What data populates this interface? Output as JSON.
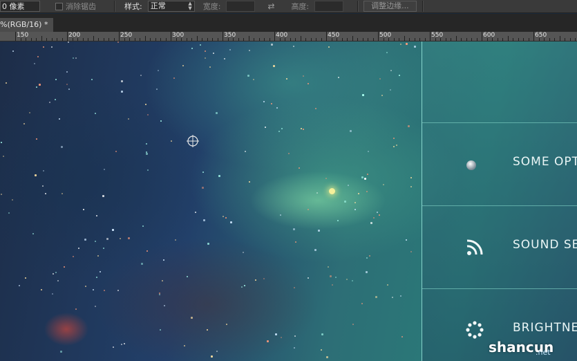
{
  "options_bar": {
    "feather_value": "0 像素",
    "anti_alias_label": "消除锯齿",
    "style_label": "样式:",
    "style_value": "正常",
    "width_label": "宽度:",
    "height_label": "高度:",
    "refine_edge_label": "调整边缘..."
  },
  "document": {
    "tab_title": "%(RGB/16) *"
  },
  "ruler": {
    "labels": [
      "150",
      "200",
      "250",
      "300",
      "350",
      "400",
      "450",
      "500",
      "550",
      "600",
      "650"
    ]
  },
  "menu": {
    "items": [
      {
        "label": "SOME OPTIONS",
        "icon": "sphere-icon"
      },
      {
        "label": "SOUND SETTINGS",
        "icon": "rss-icon"
      },
      {
        "label": "BRIGHTNESS",
        "icon": "loading-dots-icon"
      }
    ]
  },
  "watermark": {
    "main": "shancun",
    "sub": ".net"
  },
  "colors": {
    "menu_line": "#96e6dc",
    "menu_text": "#eaf6f6",
    "toolbar_bg": "#3a3a3a"
  }
}
